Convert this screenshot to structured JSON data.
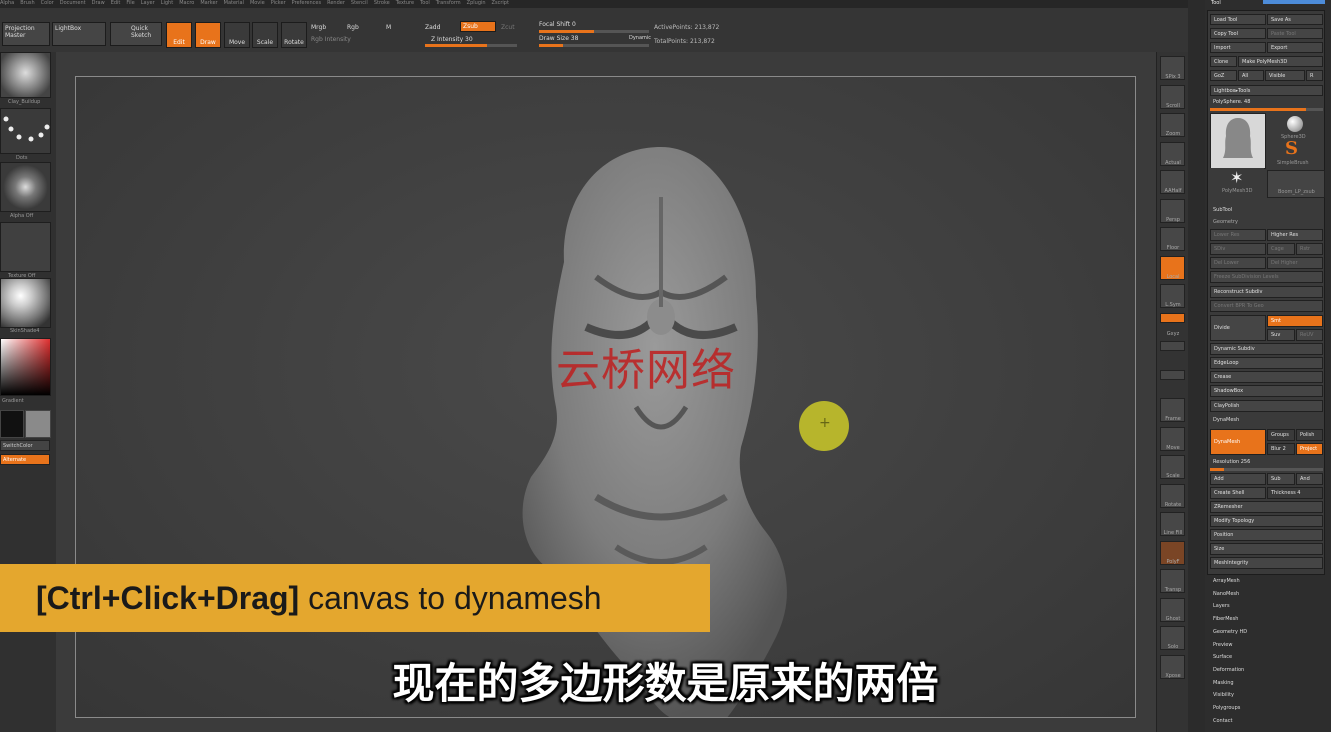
{
  "menubar": [
    "Alpha",
    "Brush",
    "Color",
    "Document",
    "Draw",
    "Edit",
    "File",
    "Layer",
    "Light",
    "Macro",
    "Marker",
    "Material",
    "Movie",
    "Picker",
    "Preferences",
    "Render",
    "Stencil",
    "Stroke",
    "Texture",
    "Tool",
    "Transform",
    "Zplugin",
    "Zscript"
  ],
  "topbar": {
    "projection_master": "Projection Master",
    "lightbox": "LightBox",
    "quick_sketch": "Quick Sketch",
    "edit": "Edit",
    "draw": "Draw",
    "move": "Move",
    "scale": "Scale",
    "rotate": "Rotate",
    "mrgb": "Mrgb",
    "rgb": "Rgb",
    "m": "M",
    "rgb_intensity": "Rgb Intensity",
    "zadd": "Zadd",
    "zsub": "Zsub",
    "zcut": "Zcut",
    "z_intensity": "Z Intensity 30",
    "focal_shift": "Focal Shift 0",
    "draw_size": "Draw Size 38",
    "dynamic": "Dynamic",
    "active_points": "ActivePoints: 213,872",
    "total_points": "TotalPoints: 213,872"
  },
  "leftbar": {
    "brush_label": "Clay_Buildup",
    "stroke_label": "Dots",
    "alpha_label": "Alpha Off",
    "texture_label": "Texture Off",
    "material_label": "SkinShade4",
    "gradient_label": "Gradient",
    "switch_color": "SwitchColor",
    "alternate": "Alternate"
  },
  "shelf": [
    "SPix 3",
    "Scroll",
    "Zoom",
    "Actual",
    "AAHalf",
    "Persp",
    "Floor",
    "Local",
    "L.Sym",
    "Gxyz",
    "",
    "",
    "Frame",
    "Move",
    "Scale",
    "Rotate",
    "Line Fill",
    "PolyF",
    "Transp",
    "Ghost",
    "Solo",
    "Xpose"
  ],
  "tray": {
    "title": "Tool",
    "load_tool": "Load Tool",
    "save_as": "Save As",
    "copy_tool": "Copy Tool",
    "paste_tool": "Paste Tool",
    "import": "Import",
    "export": "Export",
    "clone": "Clone",
    "make_polymesh": "Make PolyMesh3D",
    "goz": "GoZ",
    "all": "All",
    "visible": "Visible",
    "r": "R",
    "lightbox_tools": "Lightbox▸Tools",
    "polysphere": "PolySphere. 48",
    "tool_thumbs": [
      "Sphere3D",
      "SimpleBrush",
      "PolyMesh3D",
      "Boom_LP_zsub"
    ],
    "subtool": "SubTool",
    "geometry": "Geometry",
    "lower_res": "Lower Res",
    "higher_res": "Higher Res",
    "sdiv": "SDiv",
    "cage": "Cage",
    "rstr": "Rstr",
    "del_lower": "Del Lower",
    "del_higher": "Del Higher",
    "freeze_subdiv": "Freeze SubDivision Levels",
    "reconstruct_subdiv": "Reconstruct Subdiv",
    "convert_bpr": "Convert BPR To Geo",
    "divide": "Divide",
    "smt": "Smt",
    "suv": "Suv",
    "relax": "ReUV",
    "dynamic_subdiv": "Dynamic Subdiv",
    "edgeloop": "EdgeLoop",
    "crease": "Crease",
    "shadowbox": "ShadowBox",
    "claypolish": "ClayPolish",
    "dynamesh_section": "DynaMesh",
    "dynamesh_btn": "DynaMesh",
    "groups": "Groups",
    "polish": "Polish",
    "blur": "Blur 2",
    "project": "Project",
    "resolution": "Resolution 256",
    "add": "Add",
    "sub": "Sub",
    "and": "And",
    "create_shell": "Create Shell",
    "thickness": "Thickness 4",
    "zremesher": "ZRemesher",
    "modify_topology": "Modify Topology",
    "position": "Position",
    "size": "Size",
    "meshintegrity": "MeshIntegrity",
    "lower_sections": [
      "ArrayMesh",
      "NanoMesh",
      "Layers",
      "FiberMesh",
      "Geometry HD",
      "Preview",
      "Surface",
      "Deformation",
      "Masking",
      "Visibility",
      "Polygroups",
      "Contact"
    ]
  },
  "overlay": {
    "banner_bold": "[Ctrl+Click+Drag]",
    "banner_rest": " canvas to dynamesh",
    "subtitle": "现在的多边形数是原来的两倍",
    "watermark": "云桥网络"
  },
  "colors": {
    "accent": "#e8731b",
    "banner": "#e4a72e",
    "cursor": "#c4c22a"
  }
}
